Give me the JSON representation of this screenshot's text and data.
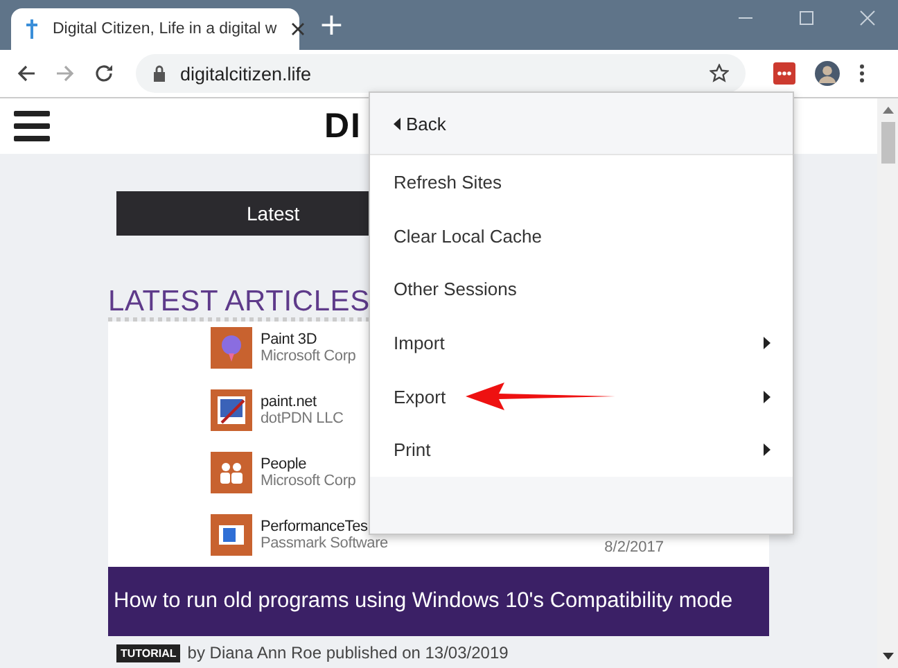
{
  "browser": {
    "tab_title": "Digital Citizen, Life in a digital w",
    "new_tab": "+",
    "address": "digitalcitizen.life"
  },
  "page": {
    "logo": "DI",
    "latest_button": "Latest",
    "section_title": "LATEST ARTICLES",
    "apps": [
      {
        "name": "Paint 3D",
        "publisher": "Microsoft Corp",
        "kind": "balloon"
      },
      {
        "name": "paint.net",
        "publisher": "dotPDN LLC",
        "kind": "picture"
      },
      {
        "name": "People",
        "publisher": "Microsoft Corp",
        "kind": "people"
      },
      {
        "name": "PerformanceTes",
        "publisher": "Passmark Software",
        "date": "8/2/2017",
        "kind": "window"
      }
    ],
    "article": {
      "title": "How to run old programs using Windows 10's Compatibility mode",
      "badge": "TUTORIAL",
      "byline": "by Diana Ann Roe published on 13/03/2019"
    }
  },
  "menu": {
    "back": "Back",
    "items": [
      {
        "label": "Refresh Sites",
        "submenu": false
      },
      {
        "label": "Clear Local Cache",
        "submenu": false
      },
      {
        "label": "Other Sessions",
        "submenu": false
      },
      {
        "label": "Import",
        "submenu": true
      },
      {
        "label": "Export",
        "submenu": true
      },
      {
        "label": "Print",
        "submenu": true
      }
    ]
  }
}
